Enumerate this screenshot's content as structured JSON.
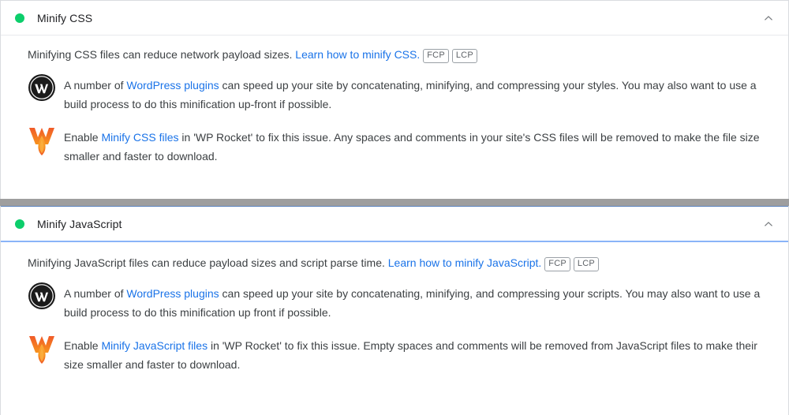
{
  "colors": {
    "pass_dot": "#0cce6b",
    "link": "#1a73e8",
    "text": "#3c4043",
    "title": "#202124",
    "border": "#dadce0",
    "focus_border": "#8ab4f8",
    "chip_border": "#9aa0a6"
  },
  "audits": [
    {
      "id": "minify-css",
      "title": "Minify CSS",
      "status": "pass",
      "expanded": true,
      "toggle_icon": "chevron-up-icon",
      "description": {
        "before_link": "Minifying CSS files can reduce network payload sizes. ",
        "link_text": "Learn how to minify CSS.",
        "after_link": ""
      },
      "metrics": [
        "FCP",
        "LCP"
      ],
      "notes": [
        {
          "icon": "wordpress-logo-icon",
          "before_link": "A number of ",
          "link_text": "WordPress plugins",
          "after_link": " can speed up your site by concatenating, minifying, and compressing your styles. You may also want to use a build process to do this minification up-front if possible."
        },
        {
          "icon": "wp-rocket-logo-icon",
          "before_link": "Enable ",
          "link_text": "Minify CSS files",
          "after_link": " in 'WP Rocket' to fix this issue. Any spaces and comments in your site's CSS files will be removed to make the file size smaller and faster to download."
        }
      ]
    },
    {
      "id": "minify-javascript",
      "title": "Minify JavaScript",
      "status": "pass",
      "expanded": true,
      "toggle_icon": "chevron-up-icon",
      "description": {
        "before_link": "Minifying JavaScript files can reduce payload sizes and script parse time. ",
        "link_text": "Learn how to minify JavaScript.",
        "after_link": ""
      },
      "metrics": [
        "FCP",
        "LCP"
      ],
      "notes": [
        {
          "icon": "wordpress-logo-icon",
          "before_link": "A number of ",
          "link_text": "WordPress plugins",
          "after_link": " can speed up your site by concatenating, minifying, and compressing your scripts. You may also want to use a build process to do this minification up front if possible."
        },
        {
          "icon": "wp-rocket-logo-icon",
          "before_link": "Enable ",
          "link_text": "Minify JavaScript files",
          "after_link": " in 'WP Rocket' to fix this issue. Empty spaces and comments will be removed from JavaScript files to make their size smaller and faster to download."
        }
      ]
    }
  ]
}
